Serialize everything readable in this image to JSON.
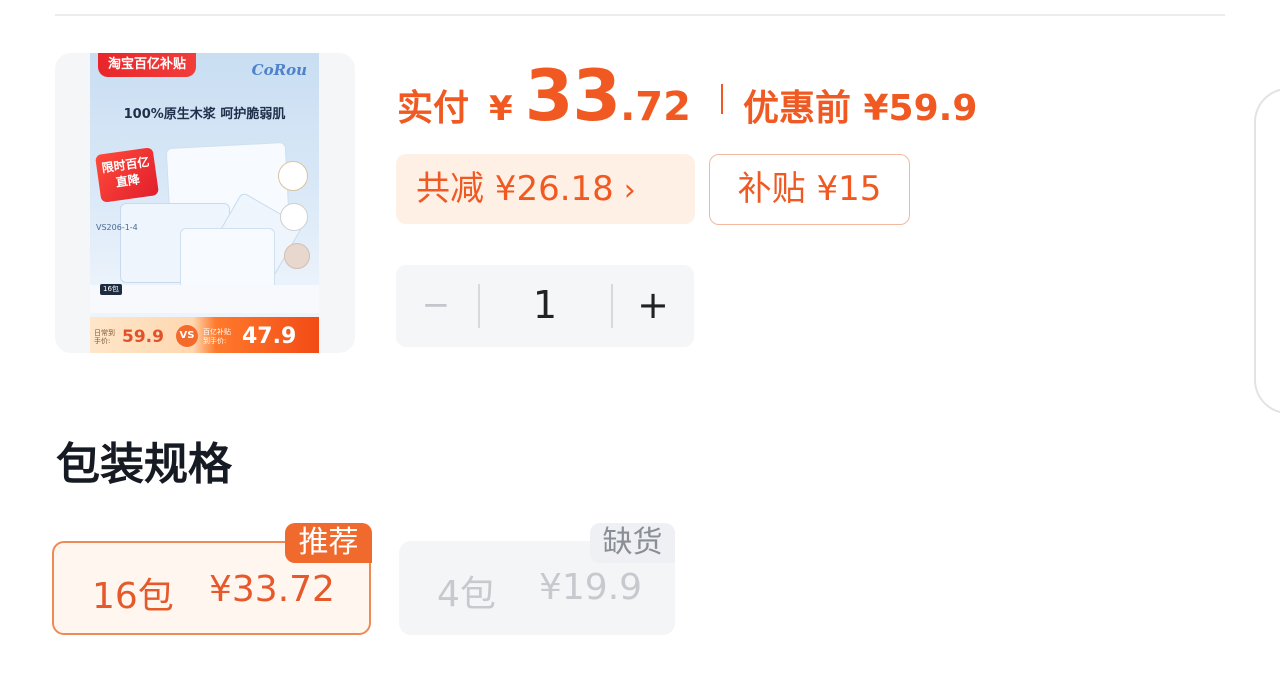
{
  "product": {
    "image": {
      "badge": "淘宝百亿补贴",
      "brand_logo": "CoRou",
      "headline": "100%原生木浆 呵护脆弱肌",
      "promo": "限时百亿直降",
      "model_code": "VS206-1-4",
      "pack_tag": "16包",
      "daily_label": "日常到手价:",
      "daily_price": "59.9",
      "vs": "VS",
      "subsidy_label": "百亿补贴 到手价:",
      "subsidy_price": "47.9"
    }
  },
  "price": {
    "pay_label": "实付",
    "currency": "¥",
    "amount_int": "33",
    "amount_dec": ".72",
    "original_label": "优惠前 ¥59.9"
  },
  "discounts": {
    "total_reduction": "共减 ¥26.18",
    "total_arrow": "›",
    "subsidy": "补贴 ¥15"
  },
  "quantity": {
    "minus": "−",
    "value": "1",
    "plus": "+"
  },
  "spec": {
    "title": "包装规格",
    "options": [
      {
        "name": "16包",
        "price": "¥33.72",
        "badge": "推荐",
        "state": "selected"
      },
      {
        "name": "4包",
        "price": "¥19.9",
        "badge": "缺货",
        "state": "out-of-stock"
      }
    ]
  },
  "colors": {
    "accent": "#f05a22",
    "chip_background": "#fff0e6",
    "selected_border": "#f08a54",
    "disabled_text": "#c7c9ce"
  }
}
